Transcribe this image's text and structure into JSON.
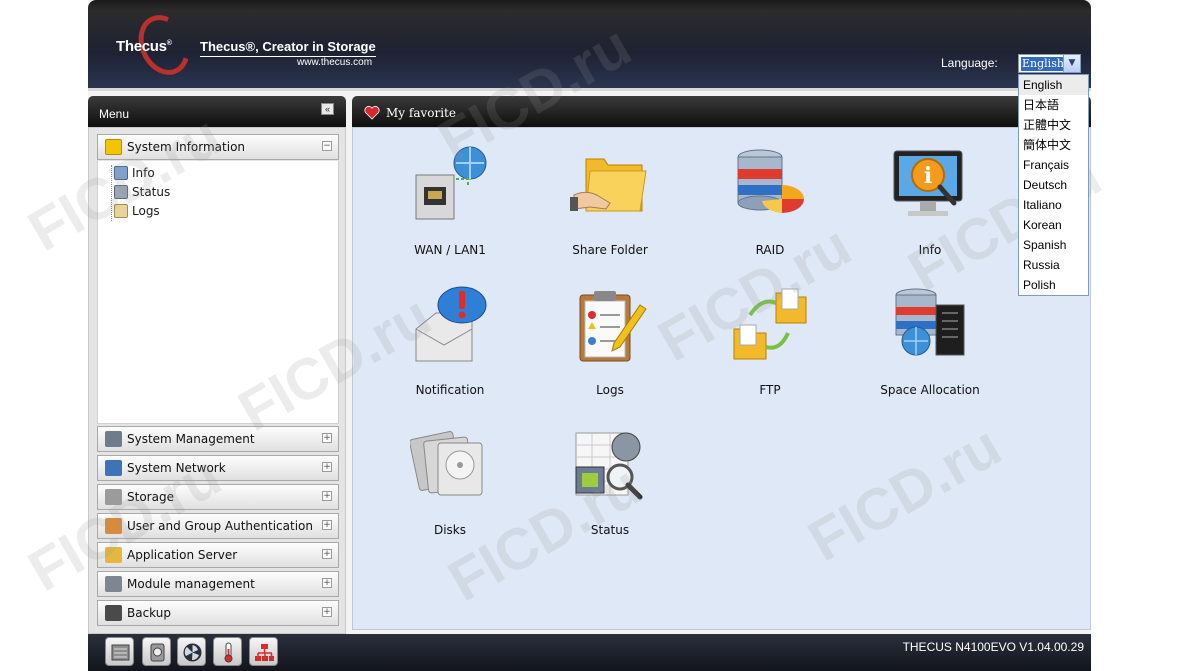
{
  "header": {
    "brand": "Thecus",
    "tagline": "Thecus®, Creator in Storage",
    "url": "www.thecus.com",
    "language_label": "Language:",
    "language_selected": "English",
    "language_options": [
      "English",
      "日本語",
      "正體中文",
      "簡体中文",
      "Français",
      "Deutsch",
      "Italiano",
      "Korean",
      "Spanish",
      "Russia",
      "Polish"
    ]
  },
  "menu": {
    "title": "Menu",
    "collapse_glyph": "«",
    "open_category": {
      "label": "System Information",
      "toggle": "−",
      "items": [
        {
          "label": "Info",
          "icon": "info-page-icon"
        },
        {
          "label": "Status",
          "icon": "status-icon"
        },
        {
          "label": "Logs",
          "icon": "logs-icon"
        }
      ]
    },
    "categories": [
      {
        "label": "System Management",
        "icon": "tools-icon",
        "toggle": "+"
      },
      {
        "label": "System Network",
        "icon": "network-icon",
        "toggle": "+"
      },
      {
        "label": "Storage",
        "icon": "storage-icon",
        "toggle": "+"
      },
      {
        "label": "User and Group Authentication",
        "icon": "users-icon",
        "toggle": "+"
      },
      {
        "label": "Application Server",
        "icon": "app-server-icon",
        "toggle": "+"
      },
      {
        "label": "Module management",
        "icon": "module-icon",
        "toggle": "+"
      },
      {
        "label": "Backup",
        "icon": "backup-icon",
        "toggle": "+"
      }
    ]
  },
  "favorites": {
    "title": "My favorite",
    "tiles": [
      {
        "label": "WAN / LAN1",
        "icon": "network-globe-icon"
      },
      {
        "label": "Share Folder",
        "icon": "share-folder-icon"
      },
      {
        "label": "RAID",
        "icon": "raid-icon"
      },
      {
        "label": "Info",
        "icon": "info-monitor-icon"
      },
      {
        "label": "Notification",
        "icon": "notification-icon"
      },
      {
        "label": "Logs",
        "icon": "logs-clipboard-icon"
      },
      {
        "label": "FTP",
        "icon": "ftp-icon"
      },
      {
        "label": "Space Allocation",
        "icon": "space-allocation-icon"
      },
      {
        "label": "Disks",
        "icon": "disks-icon"
      },
      {
        "label": "Status",
        "icon": "status-chart-icon"
      }
    ]
  },
  "footer": {
    "version": "THECUS N4100EVO V1.04.00.29",
    "buttons": [
      "hdd-status-icon",
      "disk-icon",
      "fan-icon",
      "thermometer-icon",
      "network-status-icon"
    ]
  },
  "watermark": "FICD.ru",
  "colors": {
    "accent_red": "#b9302d",
    "panel_blue": "#dfe8f6",
    "header_dark": "#1e2233"
  }
}
